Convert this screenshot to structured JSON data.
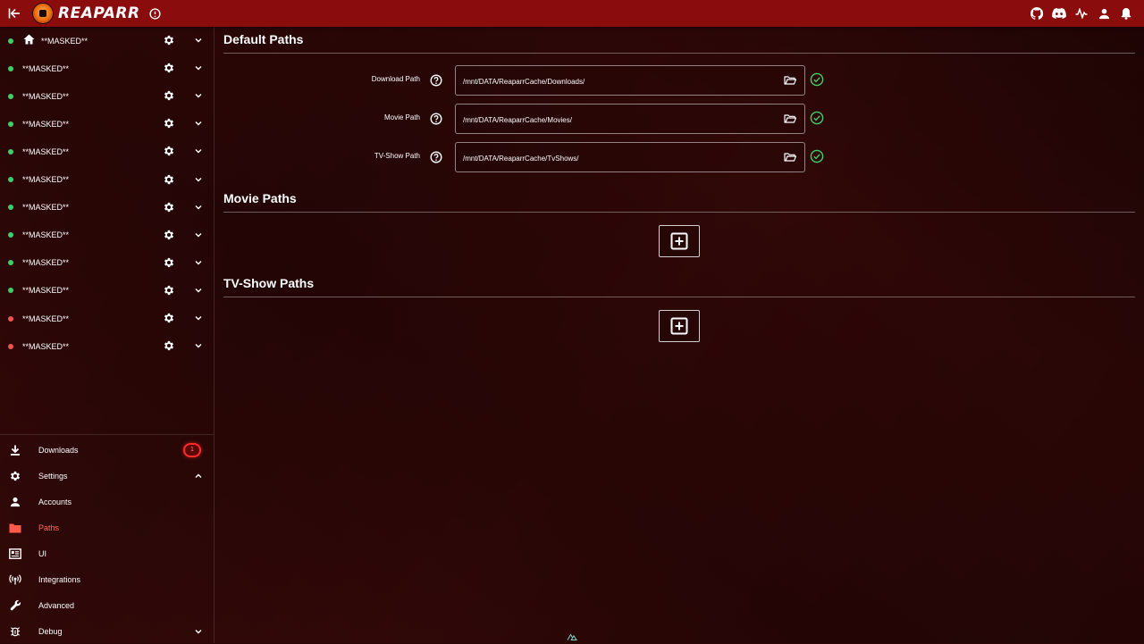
{
  "app": {
    "logo_text": "REAPARR"
  },
  "colors": {
    "topbar": "#8a0c0c",
    "status_ok": "#3fcf6a",
    "status_error": "#ef5350",
    "active_nav": "#ff6b5a",
    "valid_check": "#3fcf6a"
  },
  "topbar_icons": [
    "github-icon",
    "discord-icon",
    "activity-icon",
    "user-icon",
    "bell-icon"
  ],
  "instances": [
    {
      "name": "**MASKED**",
      "status": "ok",
      "home": true
    },
    {
      "name": "**MASKED**",
      "status": "ok"
    },
    {
      "name": "**MASKED**",
      "status": "ok"
    },
    {
      "name": "**MASKED**",
      "status": "ok"
    },
    {
      "name": "**MASKED**",
      "status": "ok"
    },
    {
      "name": "**MASKED**",
      "status": "ok"
    },
    {
      "name": "**MASKED**",
      "status": "ok"
    },
    {
      "name": "**MASKED**",
      "status": "ok"
    },
    {
      "name": "**MASKED**",
      "status": "ok"
    },
    {
      "name": "**MASKED**",
      "status": "ok"
    },
    {
      "name": "**MASKED**",
      "status": "error"
    },
    {
      "name": "**MASKED**",
      "status": "error"
    }
  ],
  "nav": {
    "downloads": {
      "label": "Downloads",
      "badge": "1"
    },
    "settings": {
      "label": "Settings"
    },
    "accounts": {
      "label": "Accounts"
    },
    "paths": {
      "label": "Paths"
    },
    "ui": {
      "label": "UI"
    },
    "integrations": {
      "label": "Integrations"
    },
    "advanced": {
      "label": "Advanced"
    },
    "debug": {
      "label": "Debug"
    }
  },
  "main": {
    "default_paths": {
      "title": "Default Paths",
      "rows": [
        {
          "label": "Download Path",
          "value": "/mnt/DATA/ReaparrCache/Downloads/"
        },
        {
          "label": "Movie Path",
          "value": "/mnt/DATA/ReaparrCache/Movies/"
        },
        {
          "label": "TV-Show Path",
          "value": "/mnt/DATA/ReaparrCache/TvShows/"
        }
      ]
    },
    "movie_paths": {
      "title": "Movie Paths"
    },
    "tvshow_paths": {
      "title": "TV-Show Paths"
    }
  }
}
